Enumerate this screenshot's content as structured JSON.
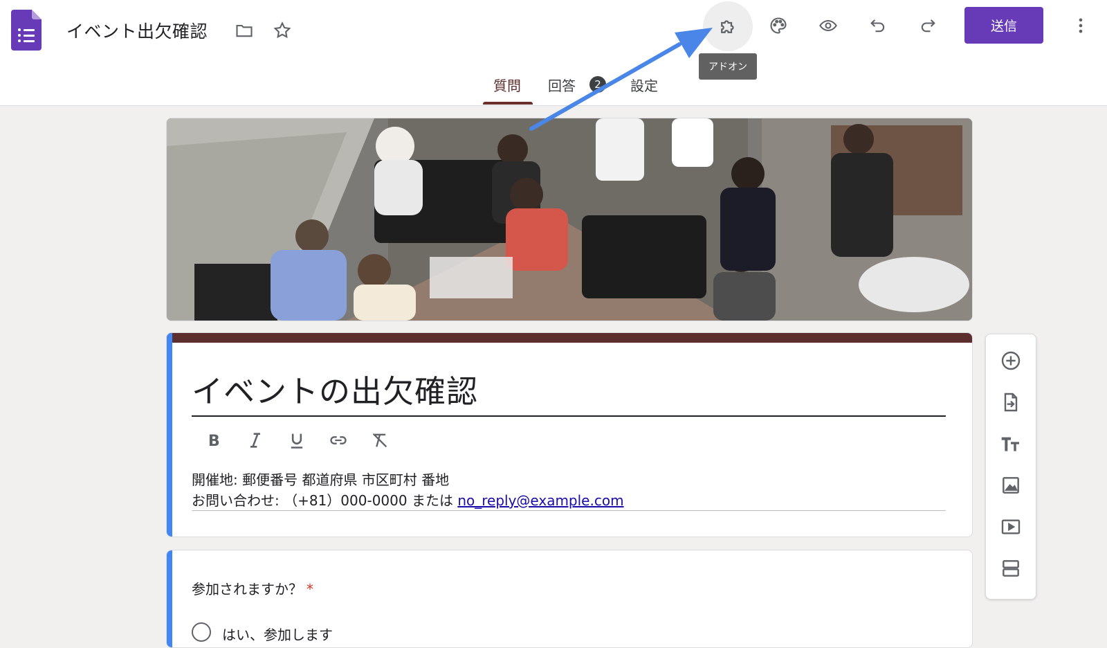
{
  "header": {
    "doc_title": "イベント出欠確認",
    "tooltip": "アドオン",
    "send_label": "送信",
    "tabs": [
      {
        "label": "質問",
        "active": true
      },
      {
        "label": "回答",
        "badge": "2"
      },
      {
        "label": "設定"
      }
    ]
  },
  "form": {
    "title": "イベントの出欠確認",
    "description_line1": "開催地: 郵便番号 都道府県 市区町村 番地",
    "description_line2_prefix": "お問い合わせ: （+81）000-0000 または ",
    "description_link": "no_reply@example.com"
  },
  "question": {
    "text": "参加されますか？",
    "required_mark": "*",
    "option_1": "はい、参加します"
  },
  "colors": {
    "accent": "#673ab7",
    "theme": "#5d2e2e",
    "highlight": "#4285f4",
    "arrow": "#4a86e8"
  }
}
